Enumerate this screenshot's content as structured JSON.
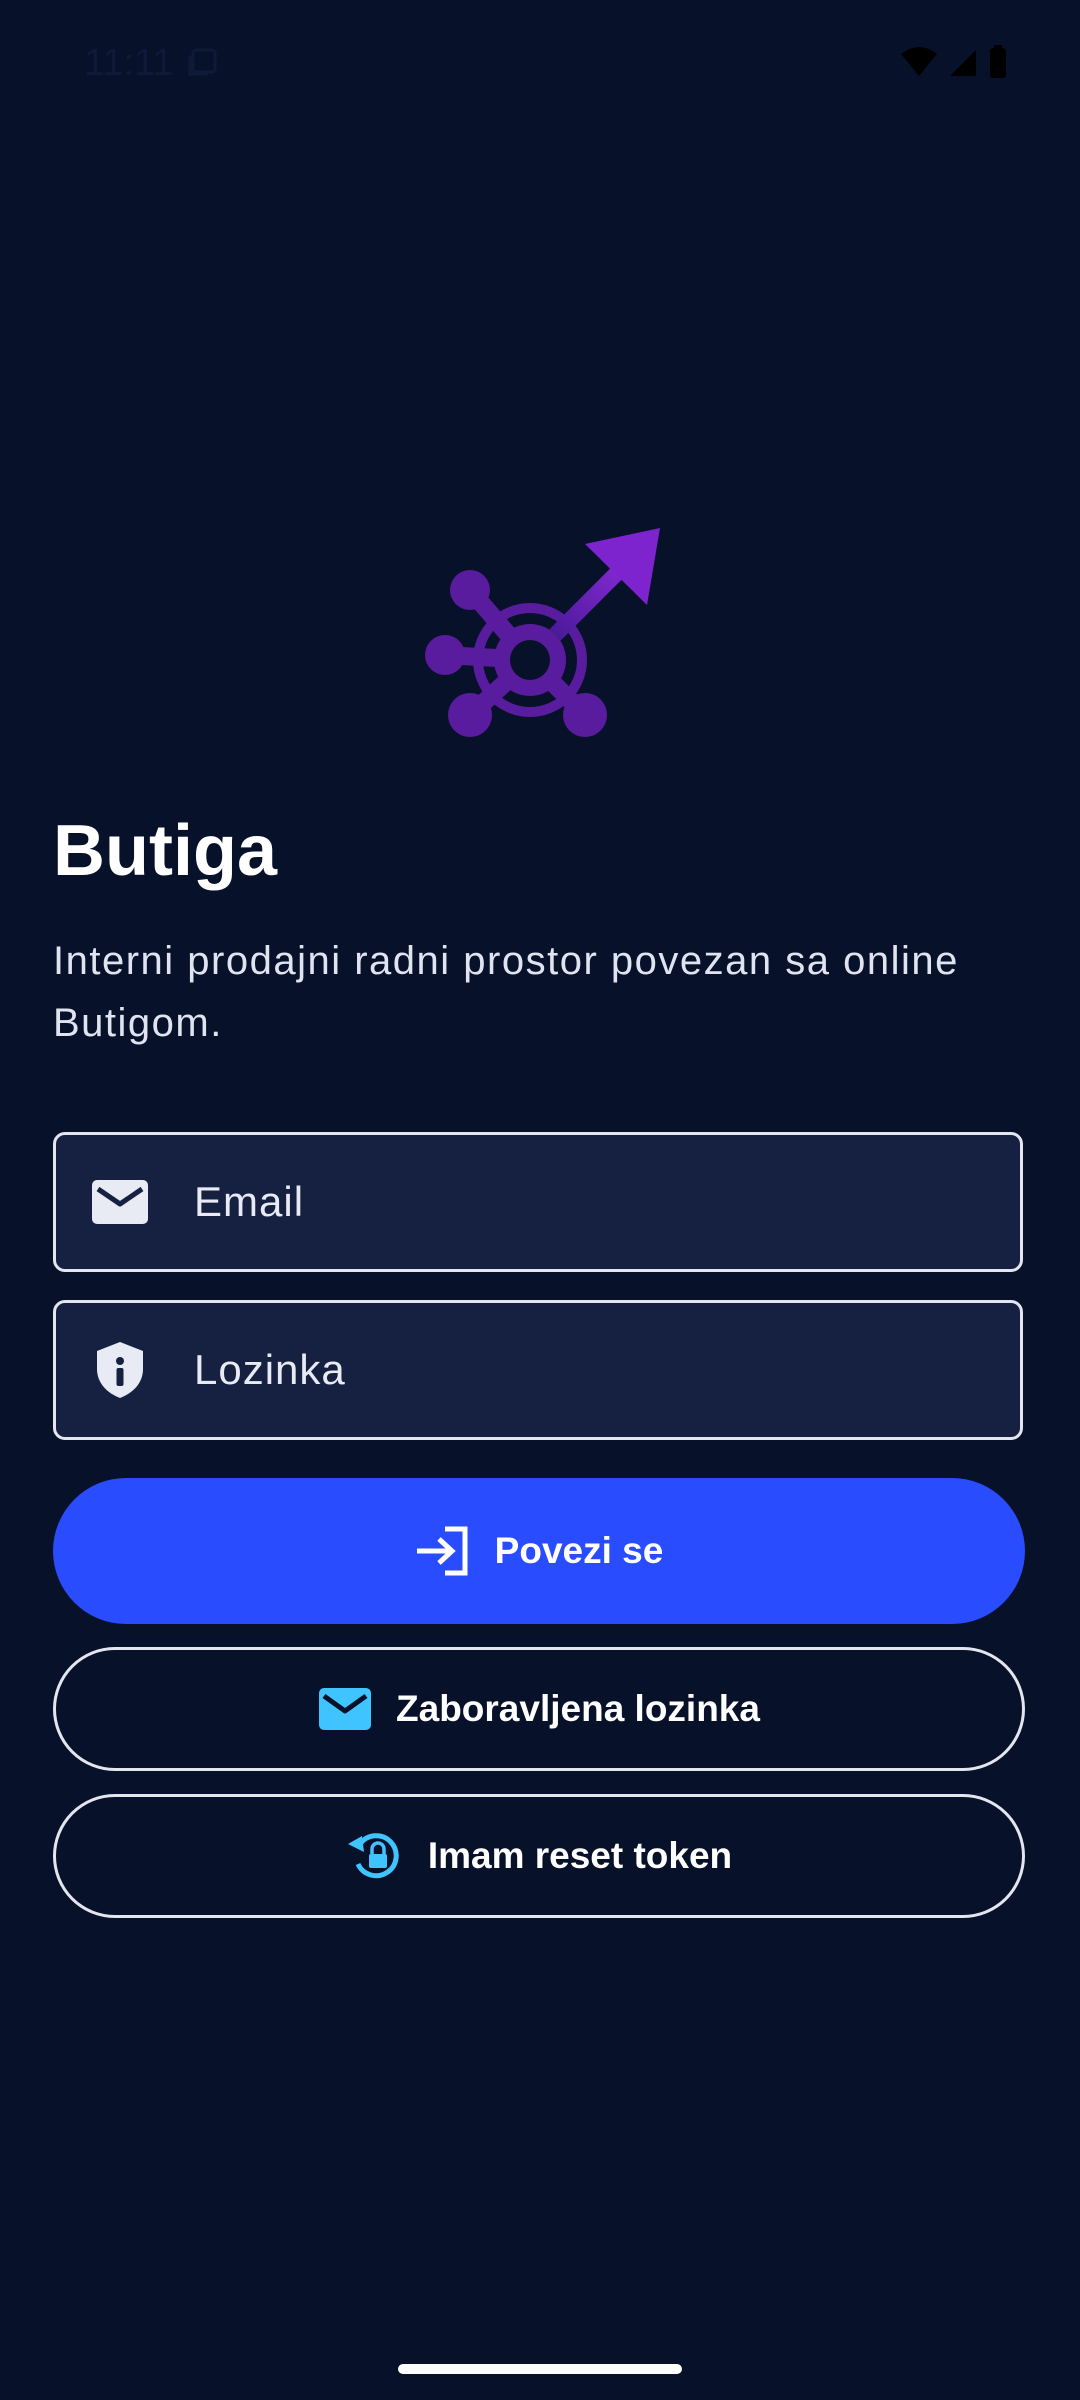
{
  "status_bar": {
    "time": "11:11"
  },
  "app": {
    "title": "Butiga",
    "subtitle": "Interni prodajni radni prostor povezan sa online Butigom."
  },
  "form": {
    "email_placeholder": "Email",
    "email_value": "",
    "password_placeholder": "Lozinka",
    "password_value": ""
  },
  "buttons": {
    "login_label": "Povezi se",
    "forgot_label": "Zaboravljena lozinka",
    "reset_token_label": "Imam reset token"
  },
  "colors": {
    "background": "#08112a",
    "field_background": "#162141",
    "primary_button": "#2a4cff",
    "accent_icon": "#3fc4ff",
    "logo_purple": "#6a1fb5"
  },
  "icons": {
    "email_field": "mail-icon",
    "password_field": "shield-info-icon",
    "login_button": "login-arrow-icon",
    "forgot_button": "mail-icon",
    "reset_button": "lock-reset-icon"
  }
}
